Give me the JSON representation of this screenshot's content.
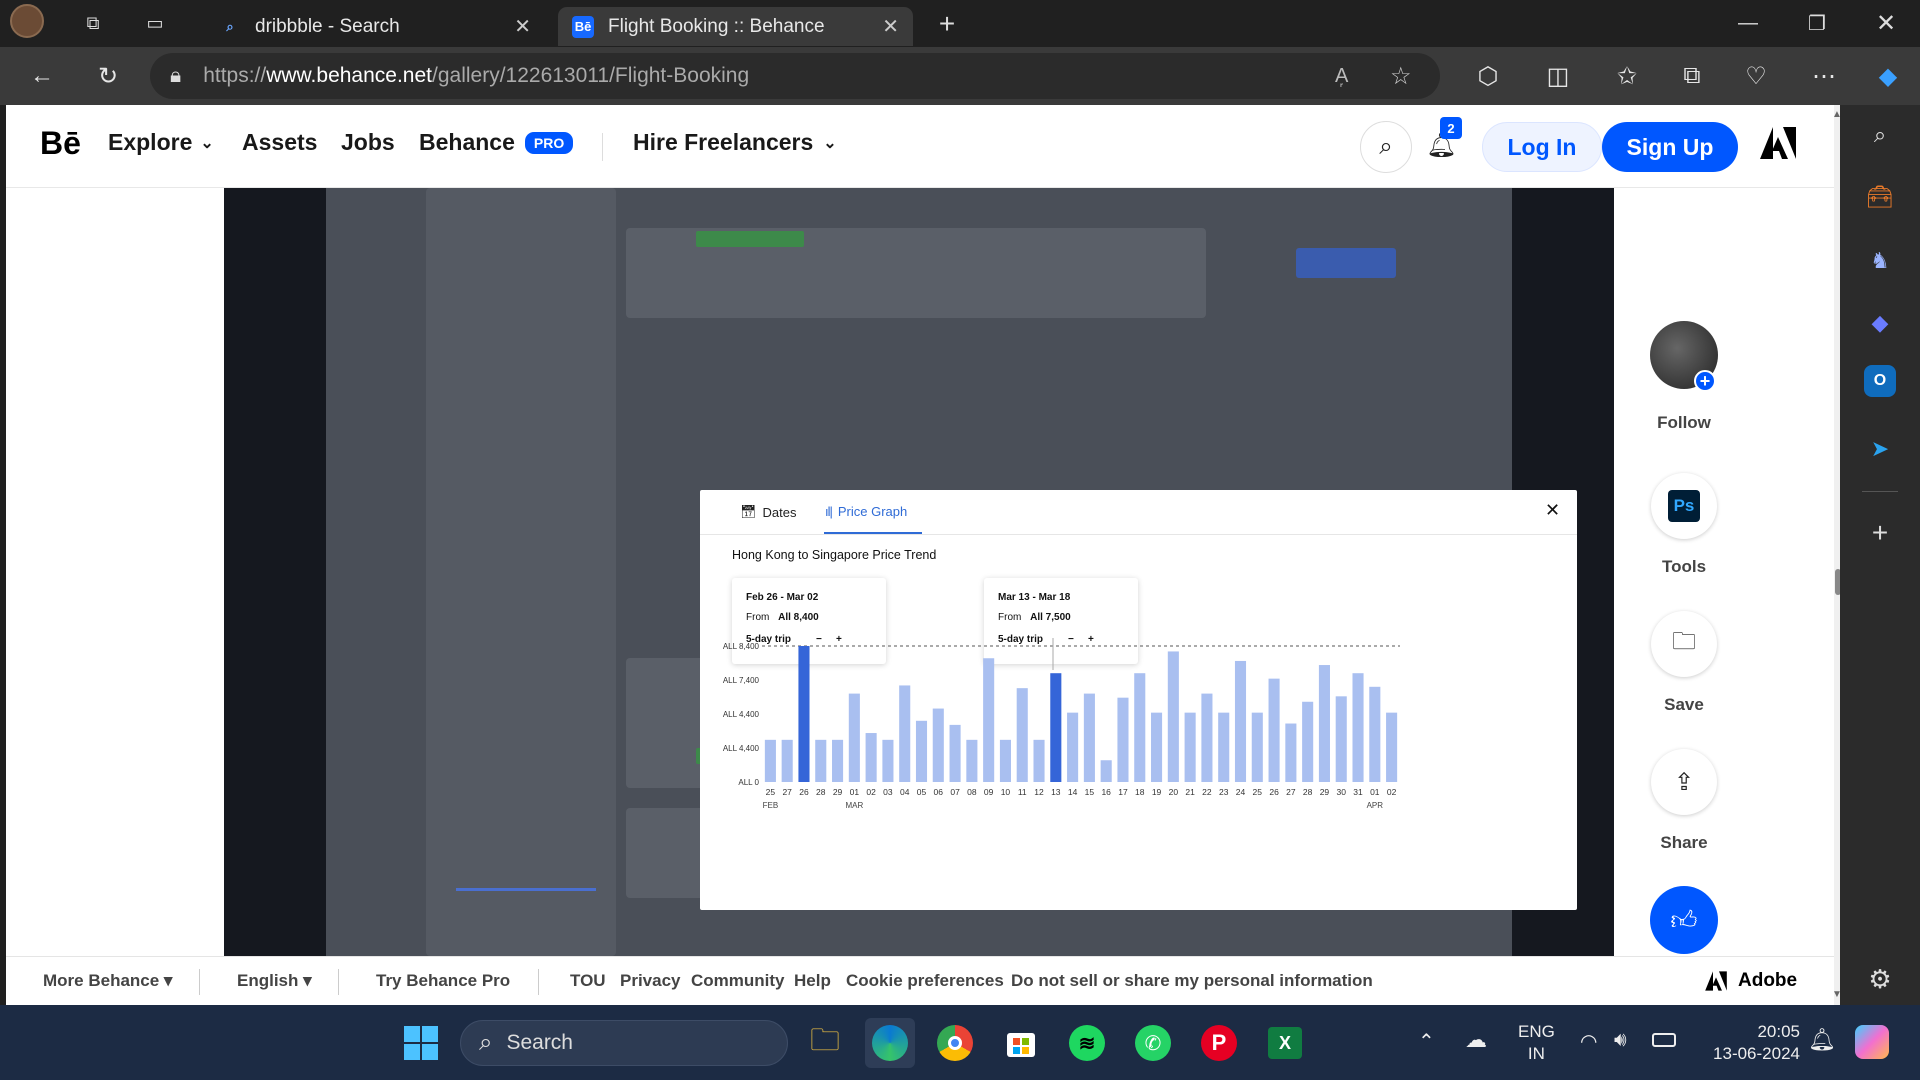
{
  "browser": {
    "tabs": [
      {
        "title": "dribbble - Search"
      },
      {
        "title": "Flight Booking :: Behance"
      }
    ],
    "url": {
      "prefix": "https://",
      "host": "www.behance.net",
      "path": "/gallery/122613011/Flight-Booking"
    }
  },
  "behance": {
    "logo": "Bē",
    "nav": {
      "explore": "Explore",
      "assets": "Assets",
      "jobs": "Jobs",
      "behance": "Behance",
      "pro": "PRO",
      "hire": "Hire Freelancers"
    },
    "notification_count": "2",
    "login": "Log In",
    "signup": "Sign Up"
  },
  "modal": {
    "tab_dates": "Dates",
    "tab_price_graph": "Price Graph",
    "title": "Hong Kong to Singapore Price Trend",
    "tip1": {
      "dates": "Feb 26 - Mar 02",
      "from_label": "From",
      "price": "All 8,400",
      "trip": "5-day trip",
      "minus": "−",
      "plus": "+"
    },
    "tip2": {
      "dates": "Mar 13 - Mar 18",
      "from_label": "From",
      "price": "All 7,500",
      "trip": "5-day trip",
      "minus": "−",
      "plus": "+"
    }
  },
  "chart_data": {
    "type": "bar",
    "title": "Hong Kong to Singapore Price Trend",
    "ytick_labels": [
      "ALL 8,400",
      "ALL 7,400",
      "ALL 4,400",
      "ALL 4,400",
      "ALL 0"
    ],
    "categories": [
      "25",
      "27",
      "26",
      "28",
      "29",
      "01",
      "02",
      "03",
      "04",
      "05",
      "06",
      "07",
      "08",
      "09",
      "10",
      "11",
      "12",
      "13",
      "14",
      "15",
      "16",
      "17",
      "18",
      "19",
      "20",
      "21",
      "22",
      "23",
      "24",
      "25",
      "26",
      "27",
      "28",
      "29",
      "30",
      "31",
      "01",
      "02"
    ],
    "month_labels": [
      {
        "label": "FEB",
        "at": "25"
      },
      {
        "label": "MAR",
        "at": "01"
      },
      {
        "label": "APR",
        "at": "01"
      }
    ],
    "values": [
      31,
      31,
      100,
      31,
      31,
      65,
      36,
      31,
      71,
      45,
      54,
      42,
      31,
      91,
      31,
      69,
      31,
      80,
      51,
      65,
      16,
      62,
      80,
      51,
      96,
      51,
      65,
      51,
      89,
      51,
      76,
      43,
      59,
      86,
      63,
      80,
      70,
      51
    ],
    "value_unit": "percent of ALL 8,400 axis line",
    "highlighted": [
      2,
      17
    ],
    "reference_line": "ALL 8,400",
    "colors": {
      "bar": "#a9bff0",
      "highlight": "#3565d8"
    }
  },
  "actions": {
    "follow": "Follow",
    "tools": "Tools",
    "ps": "Ps",
    "save": "Save",
    "share": "Share"
  },
  "footer": {
    "more": "More Behance ▾",
    "english": "English ▾",
    "try_pro": "Try Behance Pro",
    "tou": "TOU",
    "privacy": "Privacy",
    "community": "Community",
    "help": "Help",
    "cookie": "Cookie preferences",
    "dnsell": "Do not sell or share my personal information",
    "adobe": "Adobe"
  },
  "taskbar": {
    "search": "Search",
    "lang1": "ENG",
    "lang2": "IN",
    "time": "20:05",
    "date": "13-06-2024"
  }
}
